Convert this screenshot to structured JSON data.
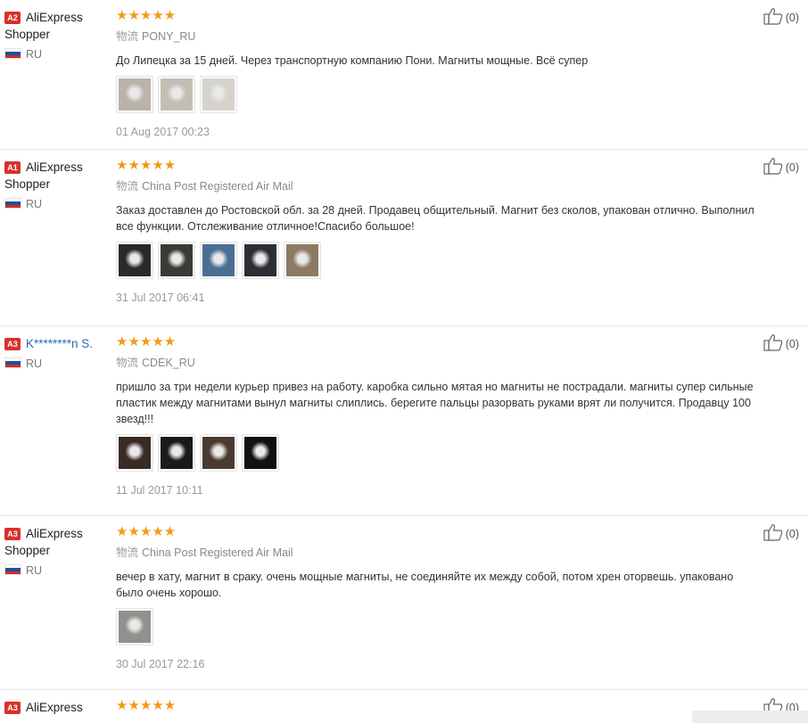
{
  "reviews": [
    {
      "user": {
        "level": "A2",
        "name": "AliExpress Shopper",
        "country": "RU"
      },
      "rating": "★★★★★",
      "logistics": {
        "icon": "物流",
        "method": "PONY_RU"
      },
      "text": "До Липецка за 15 дней. Через транспортную компанию Пони. Магниты мощные. Всё супер",
      "date": "01 Aug 2017 00:23",
      "helpful": "(0)",
      "photos": [
        "#b9b3aa",
        "#c4bdb2",
        "#d6d2cc"
      ]
    },
    {
      "user": {
        "level": "A1",
        "name": "AliExpress Shopper",
        "country": "RU"
      },
      "rating": "★★★★★",
      "logistics": {
        "icon": "物流",
        "method": "China Post Registered Air Mail"
      },
      "text": "Заказ доставлен до Ростовской обл. за 28 дней. Продавец общительный. Магнит без сколов, упакован отлично. Выполнил все функции. Отслеживание отличное!Спасибо большое!",
      "date": "31 Jul 2017 06:41",
      "helpful": "(0)",
      "photos": [
        "#2a2a2a",
        "#3a3a36",
        "#4b6f93",
        "#2d2d35",
        "#8c7a62"
      ]
    },
    {
      "user": {
        "level": "A3",
        "name": "K********n S.",
        "country": "RU"
      },
      "rating": "★★★★★",
      "logistics": {
        "icon": "物流",
        "method": "CDEK_RU"
      },
      "text": "пришло за три недели курьер привез на работу. каробка сильно мятая но магниты не пострадали. магниты супер сильные пластик между магнитами вынул магниты слиплись. берегите пальцы разорвать руками врят ли получится. Продавцу 100 звезд!!!",
      "date": "11 Jul 2017 10:11",
      "helpful": "(0)",
      "photos": [
        "#3a2a24",
        "#1a1a1a",
        "#4a3a32",
        "#111111"
      ]
    },
    {
      "user": {
        "level": "A3",
        "name": "AliExpress Shopper",
        "country": "RU"
      },
      "rating": "★★★★★",
      "logistics": {
        "icon": "物流",
        "method": "China Post Registered Air Mail"
      },
      "text": "вечер в хату, магнит в сраку. очень мощные магниты, не соединяйте их между собой, потом хрен оторвешь. упаковано было очень хорошо.",
      "date": "30 Jul 2017 22:16",
      "helpful": "(0)",
      "photos": [
        "#8e918c"
      ]
    },
    {
      "user": {
        "level": "A3",
        "name": "AliExpress",
        "country": ""
      },
      "rating": "★★★★★",
      "logistics": {
        "icon": "",
        "method": ""
      },
      "text": "",
      "date": "",
      "helpful": "(0)",
      "photos": []
    }
  ],
  "colors": {
    "star": "#f29b17",
    "level_badge": "#d9302a",
    "user_link": "#2e6bb8"
  }
}
